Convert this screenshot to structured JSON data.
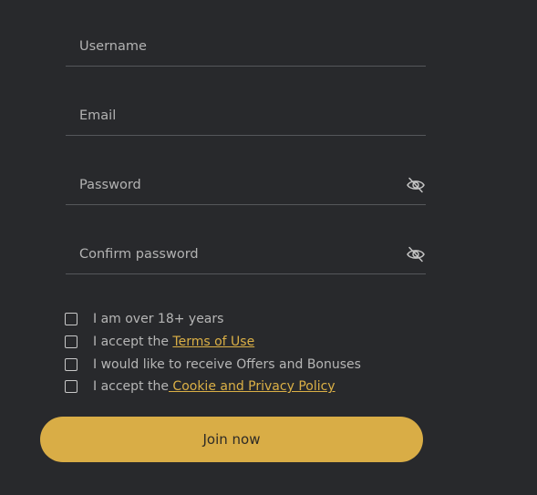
{
  "form": {
    "fields": [
      {
        "placeholder": "Username",
        "value": ""
      },
      {
        "placeholder": "Email",
        "value": ""
      },
      {
        "placeholder": "Password",
        "value": "",
        "icon": "eye-slash-icon"
      },
      {
        "placeholder": "Confirm password",
        "value": "",
        "icon": "eye-slash-icon"
      }
    ],
    "checkboxes": [
      {
        "text": "I am over 18+ years",
        "checked": false
      },
      {
        "text": "I accept the ",
        "link": "Terms of Use",
        "checked": false
      },
      {
        "text": "I would like to receive Offers and Bonuses",
        "checked": false
      },
      {
        "text": "I accept the",
        "link": " Cookie and Privacy Policy",
        "checked": false
      }
    ],
    "submit_label": "Join now"
  },
  "colors": {
    "background": "#28292c",
    "accent": "#d9ad46",
    "link": "#dbb046"
  }
}
